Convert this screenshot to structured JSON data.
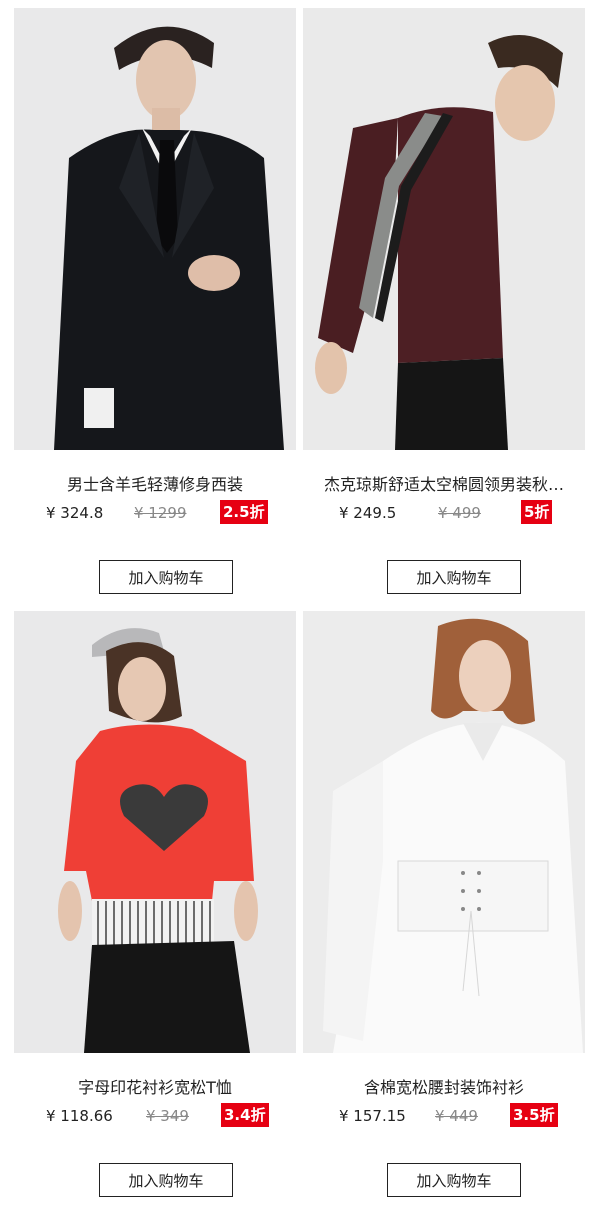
{
  "currency_symbol": "¥",
  "colors": {
    "badge": "#e60012",
    "image_bg": "#e9e9ea"
  },
  "products": [
    {
      "name": "男士含羊毛轻薄修身西装",
      "price": "¥ 324.8",
      "original_price": "¥ 1299",
      "discount": "2.5折",
      "cart_label": "加入购物车",
      "image": "man-black-suit-photo"
    },
    {
      "name": "杰克琼斯舒适太空棉圆领男装秋…",
      "price": "¥ 249.5",
      "original_price": "¥ 499",
      "discount": "5折",
      "cart_label": "加入购物车",
      "image": "man-burgundy-sweater-photo"
    },
    {
      "name": "字母印花衬衫宽松T恤",
      "price": "¥ 118.66",
      "original_price": "¥ 349",
      "discount": "3.4折",
      "cart_label": "加入购物车",
      "image": "woman-red-love-tshirt-photo"
    },
    {
      "name": "含棉宽松腰封装饰衬衫",
      "price": "¥ 157.15",
      "original_price": "¥ 449",
      "discount": "3.5折",
      "cart_label": "加入购物车",
      "image": "woman-white-shirt-photo"
    }
  ]
}
